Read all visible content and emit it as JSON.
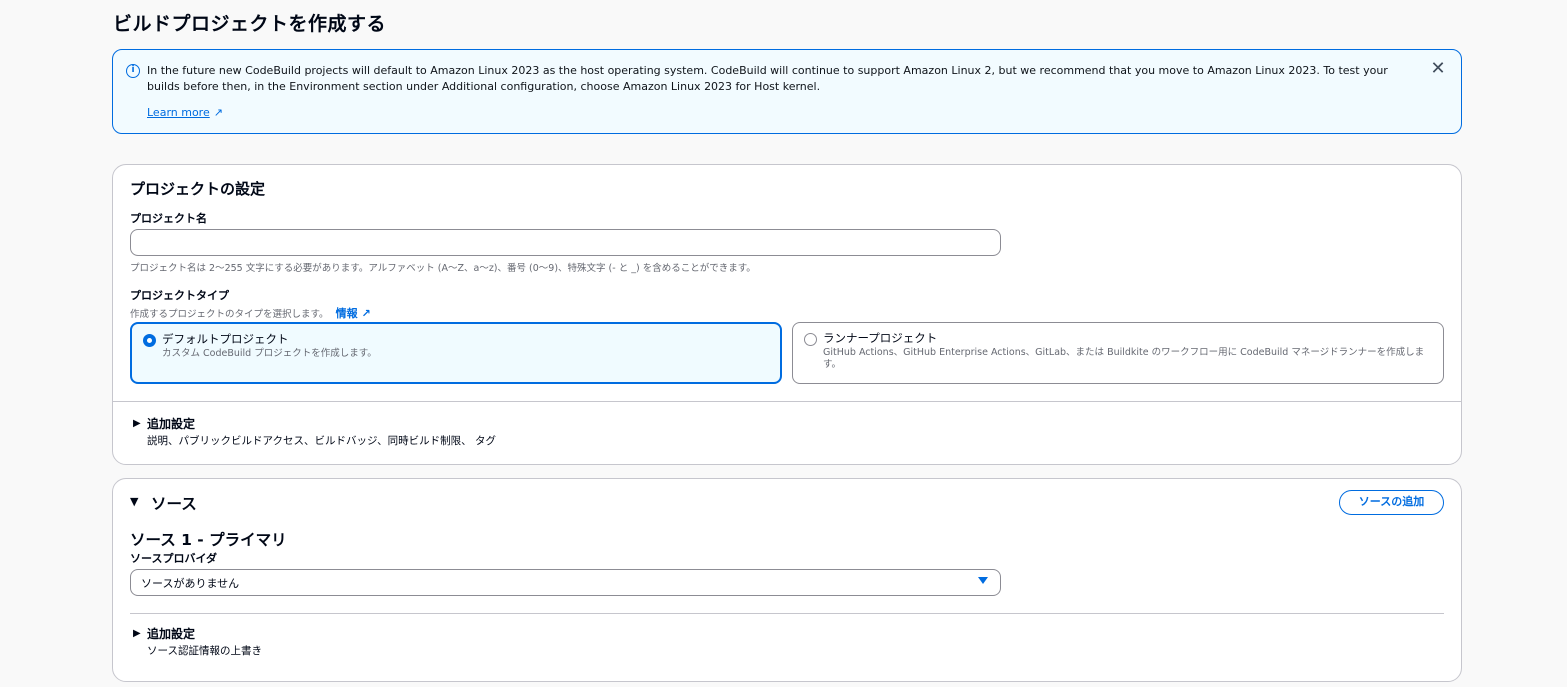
{
  "page": {
    "title": "ビルドプロジェクトを作成する"
  },
  "flash": {
    "message": "In the future new CodeBuild projects will default to Amazon Linux 2023 as the host operating system. CodeBuild will continue to support Amazon Linux 2, but we recommend that you move to Amazon Linux 2023. To test your builds before then, in the Environment section under Additional configuration, choose Amazon Linux 2023 for Host kernel.",
    "learn_more": "Learn more",
    "info_icon": "info-icon",
    "close_icon": "close-icon"
  },
  "project_settings": {
    "heading": "プロジェクトの設定",
    "name_label": "プロジェクト名",
    "name_value": "",
    "name_hint": "プロジェクト名は 2〜255 文字にする必要があります。アルファベット (A〜Z、a〜z)、番号 (0〜9)、特殊文字 (- と _) を含めることができます。",
    "type_label": "プロジェクトタイプ",
    "type_hint": "作成するプロジェクトのタイプを選択します。",
    "info_link": "情報",
    "options": [
      {
        "title": "デフォルトプロジェクト",
        "desc": "カスタム CodeBuild プロジェクトを作成します。",
        "selected": true
      },
      {
        "title": "ランナープロジェクト",
        "desc": "GitHub Actions、GitHub Enterprise Actions、GitLab、または Buildkite のワークフロー用に CodeBuild マネージドランナーを作成します。",
        "selected": false
      }
    ],
    "additional": {
      "title": "追加設定",
      "desc": "説明、パブリックビルドアクセス、ビルドバッジ、同時ビルド制限、 タグ"
    }
  },
  "source": {
    "heading": "ソース",
    "add_button": "ソースの追加",
    "primary_heading": "ソース 1 - プライマリ",
    "provider_label": "ソースプロバイダ",
    "provider_value": "ソースがありません",
    "additional": {
      "title": "追加設定",
      "desc": "ソース認証情報の上書き"
    }
  },
  "colors": {
    "accent": "#006ce0",
    "flash_bg": "#f2fbff"
  }
}
